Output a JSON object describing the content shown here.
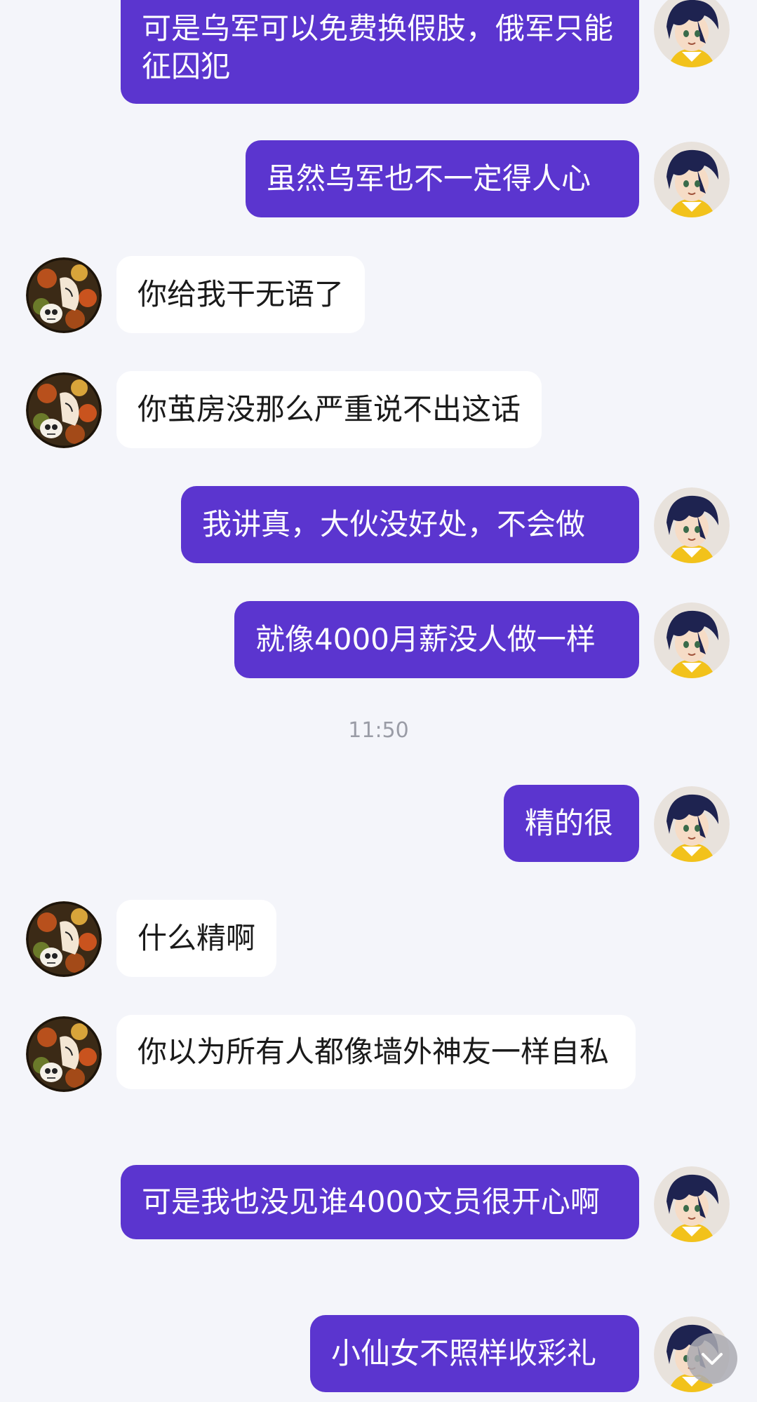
{
  "messages": [
    {
      "sender": "me",
      "text": "可是乌军可以免费换假肢，俄军只能征囚犯"
    },
    {
      "sender": "me",
      "text": "虽然乌军也不一定得人心"
    },
    {
      "sender": "other",
      "text": "你给我干无语了"
    },
    {
      "sender": "other",
      "text": "你茧房没那么严重说不出这话"
    },
    {
      "sender": "me",
      "text": "我讲真，大伙没好处，不会做"
    },
    {
      "sender": "me",
      "text": "就像4000月薪没人做一样"
    },
    {
      "sender": "me",
      "text": "精的很"
    },
    {
      "sender": "other",
      "text": "什么精啊"
    },
    {
      "sender": "other",
      "text": "你以为所有人都像墙外神友一样自私"
    },
    {
      "sender": "me",
      "text": "可是我也没见谁4000文员很开心啊"
    },
    {
      "sender": "me",
      "text": "小仙女不照样收彩礼"
    }
  ],
  "timestamp": "11:50",
  "icons": {
    "my_avatar": "anime-boy-avatar",
    "other_avatar": "floral-skull-avatar",
    "scroll_down": "chevron-down-icon"
  },
  "colors": {
    "background": "#f4f5fa",
    "my_bubble": "#5b35cf",
    "other_bubble": "#ffffff",
    "timestamp_text": "#9a9ca6"
  }
}
